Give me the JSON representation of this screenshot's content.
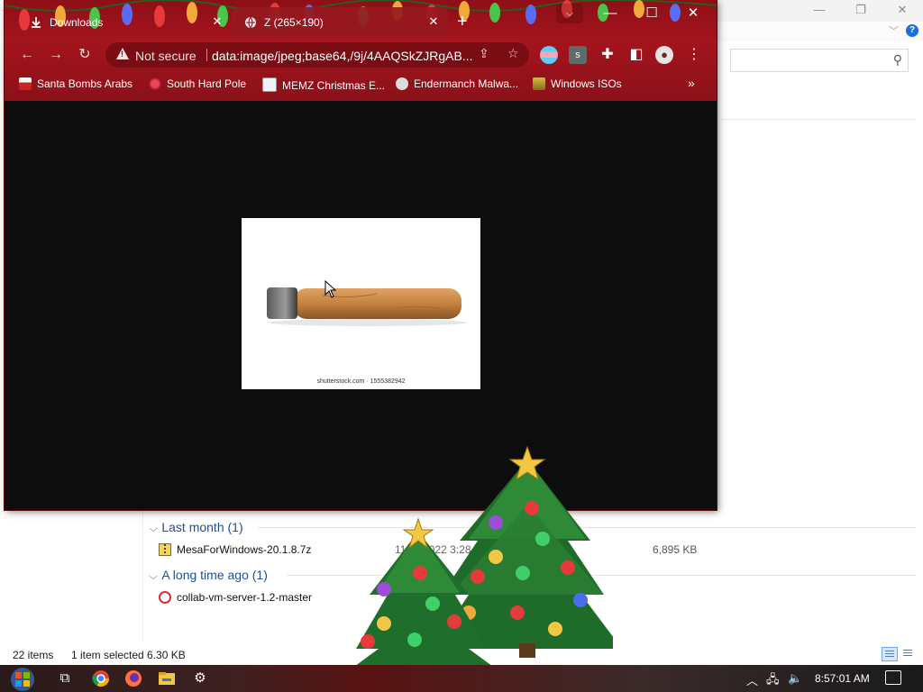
{
  "explorer": {
    "groups": [
      {
        "label": "Last month (1)"
      },
      {
        "label": "A long time ago (1)"
      }
    ],
    "files": [
      {
        "name": "MesaForWindows-20.1.8.7z",
        "date": "11/…/2022 3:28 AM",
        "size": "6,895 KB"
      },
      {
        "name": "collab-vm-server-1.2-master"
      }
    ],
    "status": {
      "items": "22 items",
      "selected": "1 item selected  6.30 KB"
    }
  },
  "chrome": {
    "tabs": [
      {
        "label": "Downloads",
        "icon": "download-icon",
        "active": false
      },
      {
        "label": "Z (265×190)",
        "icon": "globe-icon",
        "active": true
      }
    ],
    "omnibox": {
      "security_label": "Not secure",
      "url": "data:image/jpeg;base64,/9j/4AAQSkZJRgAB..."
    },
    "bookmarks": [
      {
        "label": "Santa Bombs Arabs",
        "icon": "bookmark-icon"
      },
      {
        "label": "South Hard Pole",
        "icon": "bookmark-icon"
      },
      {
        "label": "MEMZ Christmas E...",
        "icon": "bookmark-icon"
      },
      {
        "label": "Endermanch Malwa...",
        "icon": "bookmark-icon"
      },
      {
        "label": "Windows ISOs",
        "icon": "bookmark-icon"
      }
    ],
    "image_watermark": "shutterstock.com · 1555382942"
  },
  "taskbar": {
    "clock": "8:57:01 AM"
  },
  "colors": {
    "chrome_frame": "#8e0f17",
    "omnibox": "#7a0c13",
    "viewport": "#0d0d0d",
    "group_header": "#1f4e99"
  }
}
